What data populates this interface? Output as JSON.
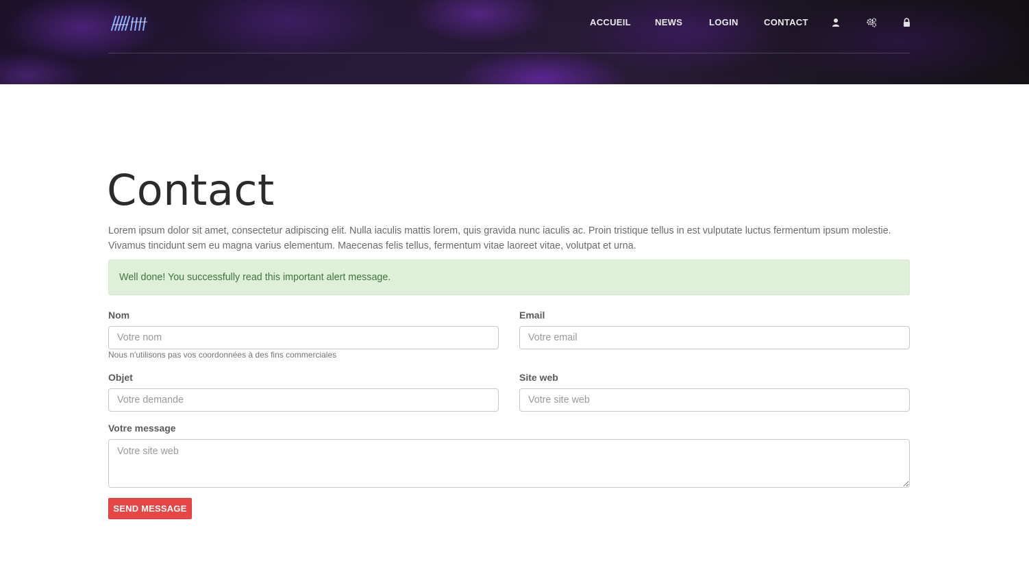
{
  "nav": {
    "items": [
      {
        "label": "ACCUEIL"
      },
      {
        "label": "NEWS"
      },
      {
        "label": "LOGIN"
      },
      {
        "label": "CONTACT"
      }
    ],
    "icons": [
      "user-icon",
      "gears-icon",
      "lock-icon"
    ],
    "logo_icon": "logo-icon"
  },
  "page": {
    "title": "Contact",
    "intro_line1": "Lorem ipsum dolor sit amet, consectetur adipiscing elit. Nulla iaculis mattis lorem, quis gravida nunc iaculis ac. Proin tristique tellus in est vulputate luctus fermentum ipsum molestie.",
    "intro_line2": "Vivamus tincidunt sem eu magna varius elementum. Maecenas felis tellus, fermentum vitae laoreet vitae, volutpat et urna."
  },
  "alert": {
    "message": "Well done! You successfully read this important alert message."
  },
  "form": {
    "nom": {
      "label": "Nom",
      "placeholder": "Votre nom",
      "value": "",
      "help": "Nous n'utilisons pas vos coordonnées à des fins commerciales"
    },
    "email": {
      "label": "Email",
      "placeholder": "Votre email",
      "value": ""
    },
    "objet": {
      "label": "Objet",
      "placeholder": "Votre demande",
      "value": ""
    },
    "site": {
      "label": "Site web",
      "placeholder": "Votre site web",
      "value": ""
    },
    "message": {
      "label": "Votre message",
      "placeholder": "Votre site web",
      "value": ""
    },
    "submit_label": "SEND MESSAGE"
  },
  "colors": {
    "button": "#e84545",
    "alert_bg": "#dff0d8",
    "alert_text": "#3c763d"
  }
}
